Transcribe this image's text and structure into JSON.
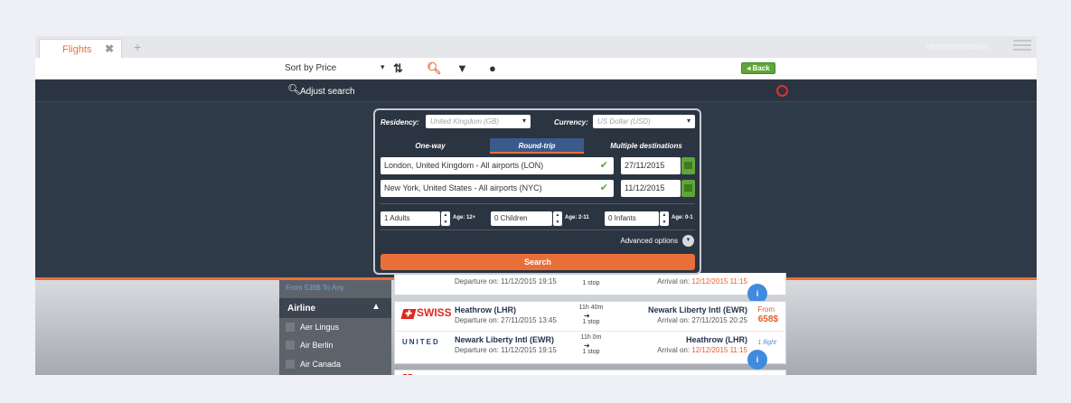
{
  "tabs": {
    "active_label": "Flights",
    "close_glyph": "✖",
    "add_glyph": "+"
  },
  "header": {
    "user_name": "demonstration"
  },
  "toolbar": {
    "sort_label": "Sort by Price",
    "back_label": "◂ Back"
  },
  "adjust": {
    "label": "Adjust search"
  },
  "search_form": {
    "residency_label": "Residency:",
    "residency_value": "United Kingdom (GB)",
    "currency_label": "Currency:",
    "currency_value": "US Dollar (USD)",
    "trip_types": [
      "One-way",
      "Round-trip",
      "Multiple destinations"
    ],
    "origin": "London, United Kingdom - All airports (LON)",
    "destination": "New York, United States - All airports (NYC)",
    "depart_date": "27/11/2015",
    "return_date": "11/12/2015",
    "adults": "1 Adults",
    "adults_age": "Age: 12+",
    "children": "0 Children",
    "children_age": "Age: 2-11",
    "infants": "0 Infants",
    "infants_age": "Age: 0-1",
    "advanced_label": "Advanced options",
    "search_label": "Search"
  },
  "filters": {
    "hint": "From 539$ To Any",
    "airline_header": "Airline",
    "airlines": [
      "Aer Lingus",
      "Air Berlin",
      "Air Canada"
    ]
  },
  "results": {
    "partial_top": {
      "departure": "Departure on: 11/12/2015 19:15",
      "stops": "1 stop",
      "arrival_prefix": "Arrival on:",
      "arrival_date": "12/12/2015 11:15"
    },
    "card": {
      "outbound": {
        "airline": "SWISS",
        "from": "Heathrow (LHR)",
        "departure": "Departure on: 27/11/2015 13:45",
        "duration": "11h 40m",
        "stops": "1 stop",
        "to": "Newark Liberty Intl (EWR)",
        "arrival": "Arrival on: 27/11/2015 20:25"
      },
      "inbound": {
        "airline": "UNITED",
        "from": "Newark Liberty Intl (EWR)",
        "departure": "Departure on: 11/12/2015 19:15",
        "duration": "11h 0m",
        "stops": "1 stop",
        "to": "Heathrow (LHR)",
        "arrival_prefix": "Arrival on:",
        "arrival_date": "12/12/2015 11:15"
      },
      "from_label": "From",
      "price": "658$",
      "flights_count": "1 flight",
      "info_label": "i"
    }
  },
  "colors": {
    "accent": "#e96f3a",
    "dark_panel": "#2b3441",
    "green": "#5fa637",
    "blue": "#3e8be0"
  }
}
